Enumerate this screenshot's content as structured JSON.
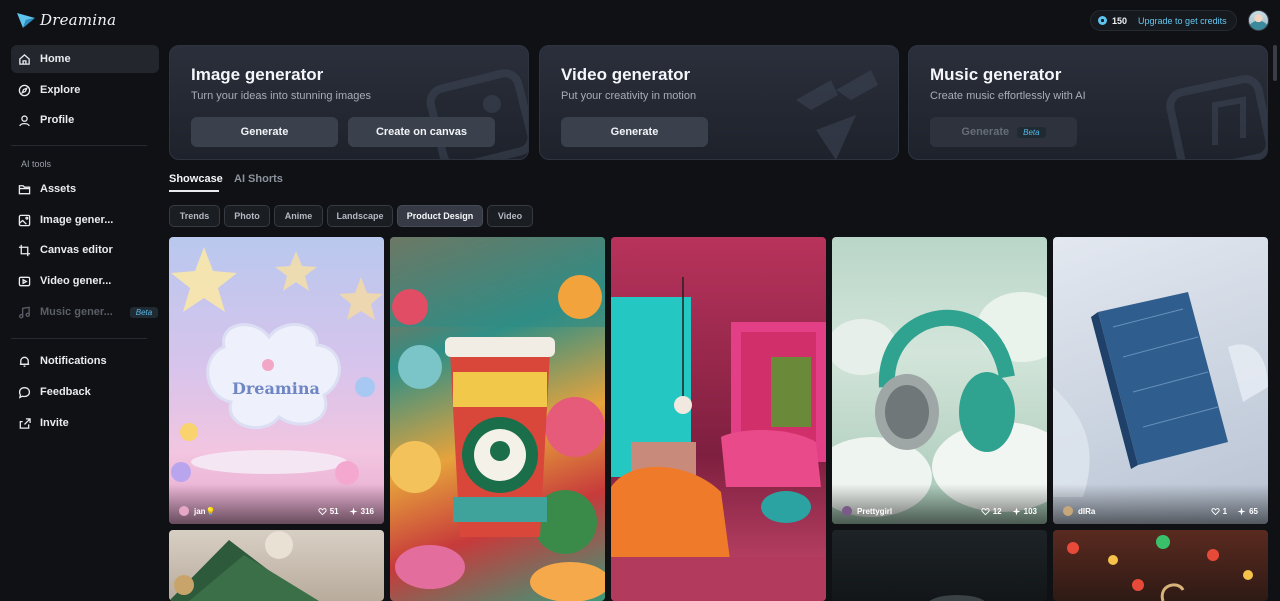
{
  "app": {
    "name": "Dreamina"
  },
  "sidebar": {
    "items": [
      {
        "label": "Home",
        "icon": "home-icon",
        "active": true
      },
      {
        "label": "Explore",
        "icon": "compass-icon"
      },
      {
        "label": "Profile",
        "icon": "user-icon"
      }
    ],
    "section_label": "AI tools",
    "tools": [
      {
        "label": "Assets",
        "icon": "folder-icon"
      },
      {
        "label": "Image gener...",
        "icon": "image-icon"
      },
      {
        "label": "Canvas editor",
        "icon": "crop-icon"
      },
      {
        "label": "Video gener...",
        "icon": "video-icon"
      },
      {
        "label": "Music gener...",
        "icon": "music-icon",
        "badge": "Beta",
        "disabled": true
      }
    ],
    "bottom": [
      {
        "label": "Notifications",
        "icon": "bell-icon"
      },
      {
        "label": "Feedback",
        "icon": "chat-icon"
      },
      {
        "label": "Invite",
        "icon": "share-icon"
      }
    ]
  },
  "header": {
    "credits": "150",
    "upgrade_label": "Upgrade to get credits"
  },
  "cards": {
    "image": {
      "title": "Image generator",
      "subtitle": "Turn your ideas into stunning images",
      "generate": "Generate",
      "canvas": "Create on canvas"
    },
    "video": {
      "title": "Video generator",
      "subtitle": "Put your creativity in motion",
      "generate": "Generate"
    },
    "music": {
      "title": "Music generator",
      "subtitle": "Create music effortlessly with AI",
      "generate": "Generate",
      "badge": "Beta"
    }
  },
  "tabs": [
    "Showcase",
    "AI Shorts"
  ],
  "filters": [
    "Trends",
    "Photo",
    "Anime",
    "Landscape",
    "Product Design",
    "Video"
  ],
  "active_filter": "Product Design",
  "gallery": [
    {
      "user": "jan💡",
      "likes": "51",
      "remixes": "316"
    },
    {
      "user": "",
      "likes": "",
      "remixes": ""
    },
    {
      "user": "",
      "likes": "",
      "remixes": ""
    },
    {
      "user": "Prettygirl",
      "likes": "12",
      "remixes": "103"
    },
    {
      "user": "dIRa",
      "likes": "1",
      "remixes": "65"
    }
  ],
  "colors": {
    "accent": "#5ec3ef",
    "background": "#0f1115",
    "card": "#262b36"
  }
}
